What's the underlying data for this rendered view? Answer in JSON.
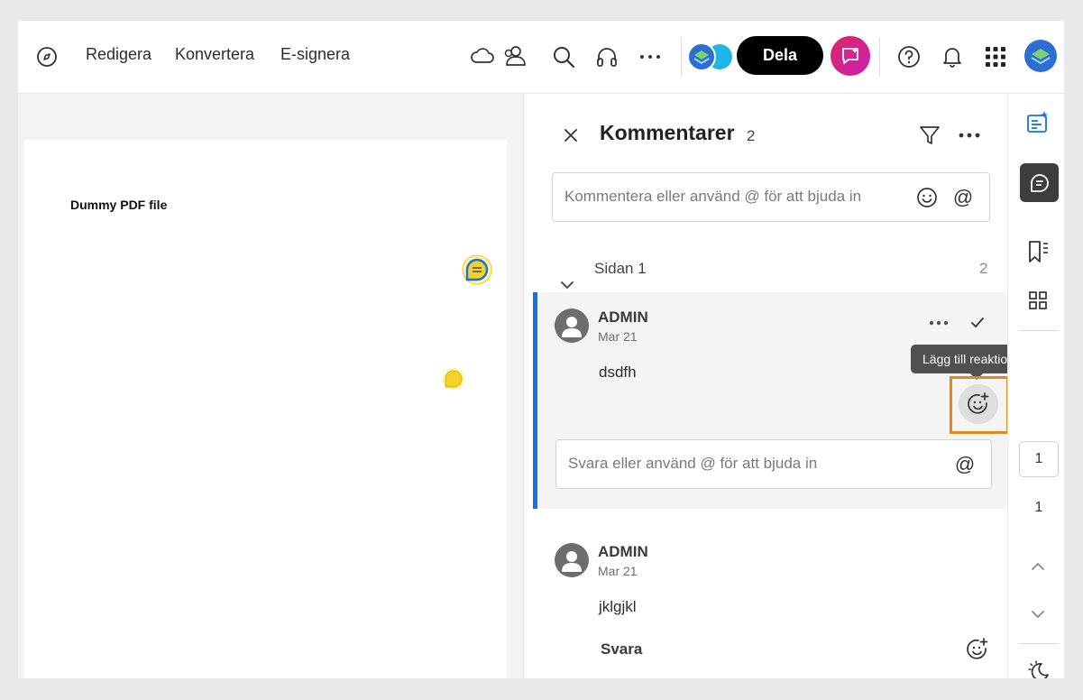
{
  "topbar": {
    "menu": [
      "Redigera",
      "Konvertera",
      "E-signera"
    ],
    "share_label": "Dela",
    "icons": [
      "compass-icon",
      "cloud-icon",
      "people-icon",
      "search-icon",
      "headphones-icon",
      "more-icon",
      "avatar-group-icon",
      "ai-assistant-icon",
      "help-icon",
      "bell-icon",
      "apps-grid-icon",
      "user-avatar-icon"
    ]
  },
  "document": {
    "title": "Dummy PDF file"
  },
  "comments": {
    "title": "Kommentarer",
    "count": "2",
    "input_placeholder": "Kommentera eller använd @ för att bjuda in",
    "section_label": "Sidan 1",
    "section_count": "2",
    "threads": [
      {
        "author": "ADMIN",
        "date": "Mar 21",
        "text": "dsdfh",
        "reply_placeholder": "Svara eller använd @ för att bjuda in"
      },
      {
        "author": "ADMIN",
        "date": "Mar 21",
        "text": "jklgjkl",
        "reply_label": "Svara"
      }
    ],
    "tooltip": "Lägg till reaktioner"
  },
  "rail": {
    "current_page": "1",
    "total_pages": "1"
  },
  "colors": {
    "accent": "#1473e6",
    "highlight": "#e08a1e",
    "share_bg": "#000000"
  }
}
